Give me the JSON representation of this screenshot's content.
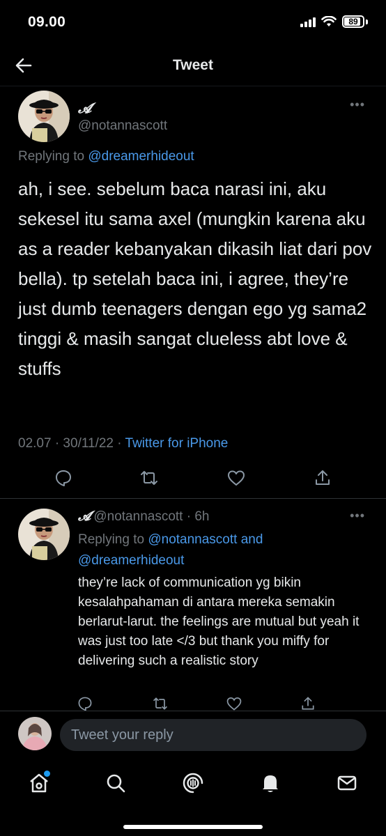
{
  "status_bar": {
    "time": "09.00",
    "battery": "89",
    "battery_level": 0.89
  },
  "nav": {
    "title": "Tweet"
  },
  "main_tweet": {
    "display_name": "𝓐",
    "handle": "@notannascott",
    "replying_prefix": "Replying to ",
    "replying_to": "@dreamerhideout",
    "text": "ah, i see. sebelum baca narasi ini, aku sekesel itu sama axel (mungkin karena aku as a reader kebanyakan dikasih liat dari pov bella). tp setelah baca ini, i agree, they’re just dumb teenagers dengan ego yg sama2 tinggi & masih sangat clueless abt love & stuffs",
    "timestamp": "02.07 · 30/11/22 · ",
    "source": "Twitter for iPhone"
  },
  "reply_tweet": {
    "display_name": "𝓐",
    "handle_time": "@notannascott · 6h",
    "replying_prefix": "Replying to ",
    "replying_to_1": "@notannascott",
    "replying_and": " and ",
    "replying_to_2": "@dreamerhideout",
    "text": "they’re lack of communication yg bikin kesalahpahaman di antara mereka semakin berlarut-larut. the feelings are mutual but yeah it was just too late </3 but thank you miffy for delivering such a realistic story"
  },
  "compose": {
    "placeholder": "Tweet your reply"
  },
  "icons": {
    "back": "arrow-left-icon",
    "more": "more-horizontal-icon",
    "reply": "reply-bubble-icon",
    "retweet": "retweet-icon",
    "like": "heart-icon",
    "share": "share-icon",
    "tabs": [
      "home-icon",
      "search-icon",
      "spaces-icon",
      "notifications-bell-icon",
      "messages-envelope-icon"
    ]
  },
  "colors": {
    "link": "#4a99e9",
    "muted": "#71767b",
    "background": "#000000",
    "text": "#e7e9ea",
    "notification_dot": "#1d9bf0"
  }
}
